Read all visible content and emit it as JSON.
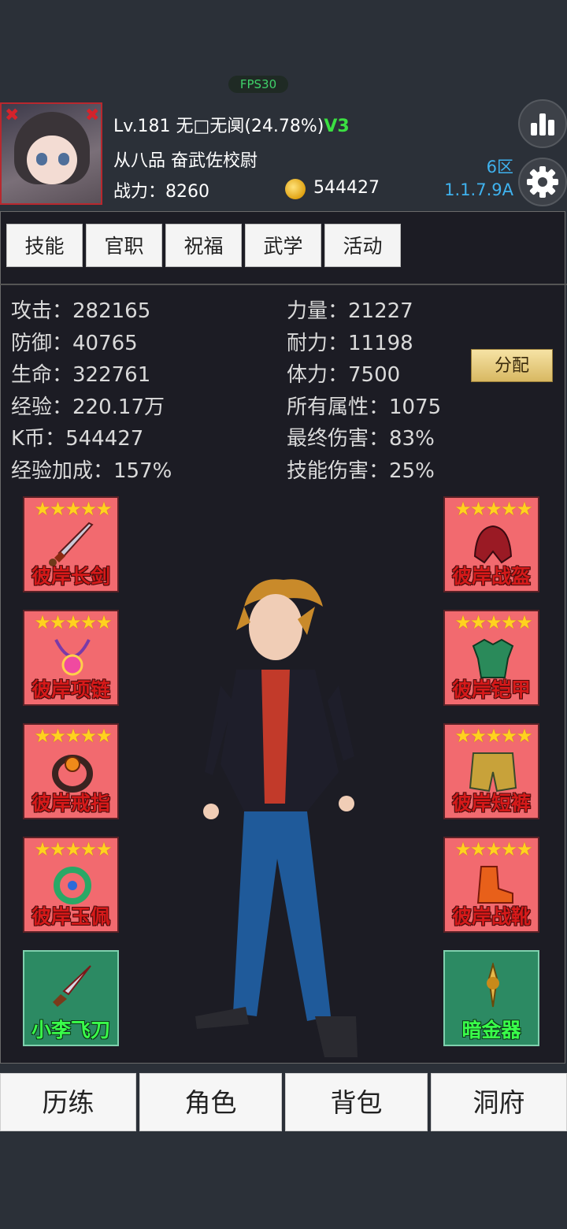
{
  "hud": {
    "fps": "FPS30"
  },
  "player": {
    "level_name": "Lv.181 无□无阒(24.78%)",
    "vip": "V3",
    "rank_title": "从八品 奋武佐校尉",
    "power_label": "战力：",
    "power_value": "8260",
    "gold": "544427",
    "zone": "6区",
    "version": "1.1.7.9A"
  },
  "tabs": [
    "技能",
    "官职",
    "祝福",
    "武学",
    "活动"
  ],
  "stats_left": [
    {
      "label": "攻击：",
      "value": "282165"
    },
    {
      "label": "防御：",
      "value": "40765"
    },
    {
      "label": "生命：",
      "value": "322761"
    },
    {
      "label": "经验：",
      "value": "220.17万"
    },
    {
      "label": "K币：",
      "value": "544427"
    },
    {
      "label": "经验加成：",
      "value": "157%"
    }
  ],
  "stats_right": [
    {
      "label": "力量：",
      "value": "21227"
    },
    {
      "label": "耐力：",
      "value": "11198"
    },
    {
      "label": "体力：",
      "value": "7500"
    },
    {
      "label": "所有属性：",
      "value": "1075"
    },
    {
      "label": "最终伤害：",
      "value": "83%"
    },
    {
      "label": "技能伤害：",
      "value": "25%"
    }
  ],
  "allocate_label": "分配",
  "equipment_left": [
    {
      "name": "彼岸长剑",
      "stars": "★★★★★",
      "icon": "sword-icon"
    },
    {
      "name": "彼岸项链",
      "stars": "★★★★★",
      "icon": "necklace-icon"
    },
    {
      "name": "彼岸戒指",
      "stars": "★★★★★",
      "icon": "ring-icon"
    },
    {
      "name": "彼岸玉佩",
      "stars": "★★★★★",
      "icon": "jade-pendant-icon"
    },
    {
      "name": "小李飞刀",
      "icon": "throwing-knife-icon"
    }
  ],
  "equipment_right": [
    {
      "name": "彼岸战盔",
      "stars": "★★★★★",
      "icon": "helmet-icon"
    },
    {
      "name": "彼岸铠甲",
      "stars": "★★★★★",
      "icon": "armor-icon"
    },
    {
      "name": "彼岸短裤",
      "stars": "★★★★★",
      "icon": "shorts-icon"
    },
    {
      "name": "彼岸战靴",
      "stars": "★★★★★",
      "icon": "boots-icon"
    },
    {
      "name": "暗金器",
      "icon": "hidden-weapon-icon"
    }
  ],
  "bottom_nav": [
    "历练",
    "角色",
    "背包",
    "洞府"
  ],
  "colors": {
    "background": "#2b3038",
    "panel": "#1c1c24",
    "equip_red": "#f26a6f",
    "equip_green": "#2c8a63",
    "vip_green": "#3be042",
    "zone_blue": "#3fb2ee"
  }
}
